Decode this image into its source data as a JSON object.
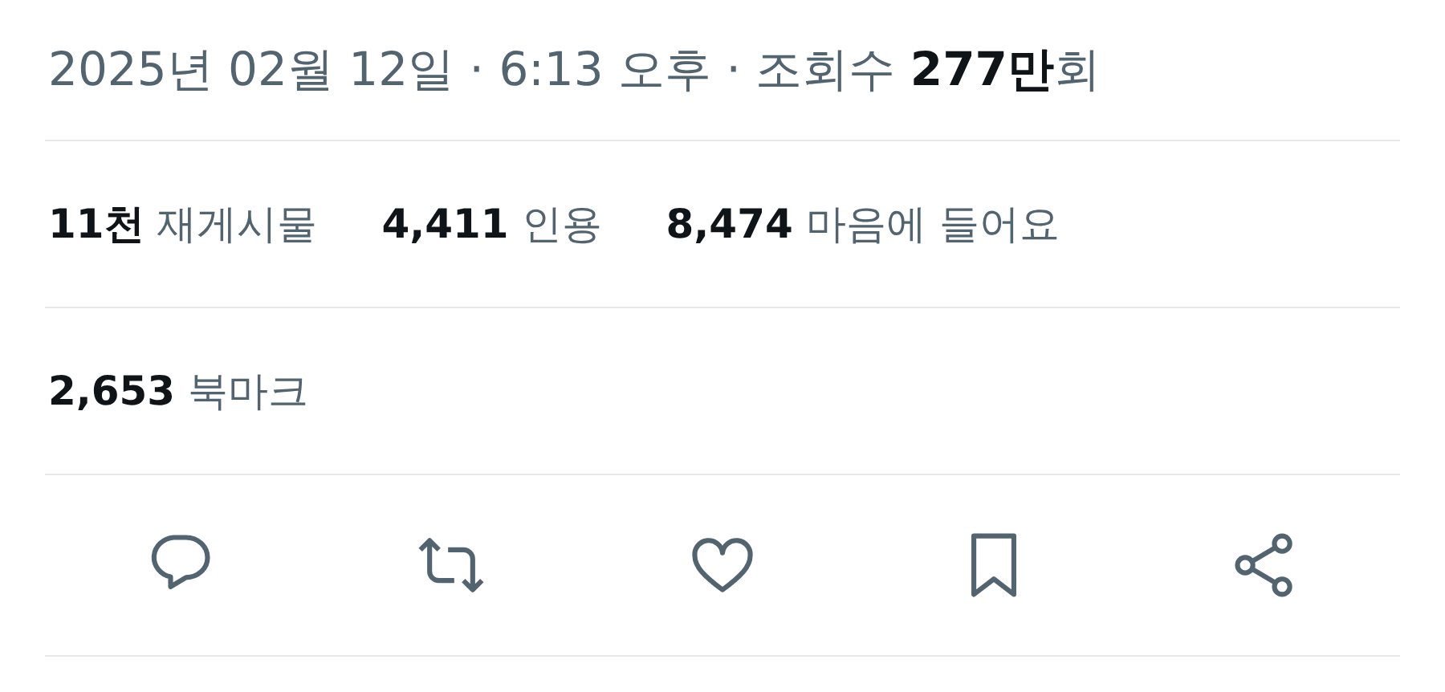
{
  "meta": "2025년 02월 12일 · 6:13 오후 · 조회수 **277만**회",
  "stats": [
    "**11천** 재게시물",
    "**4,411** 인용",
    "**8,474** 마음에 들어요"
  ],
  "bookmarks": "**2,653** 북마크",
  "actions": [
    {
      "kind": "reply"
    },
    {
      "kind": "repost"
    },
    {
      "kind": "like"
    },
    {
      "kind": "bookmark"
    },
    {
      "kind": "share"
    }
  ]
}
